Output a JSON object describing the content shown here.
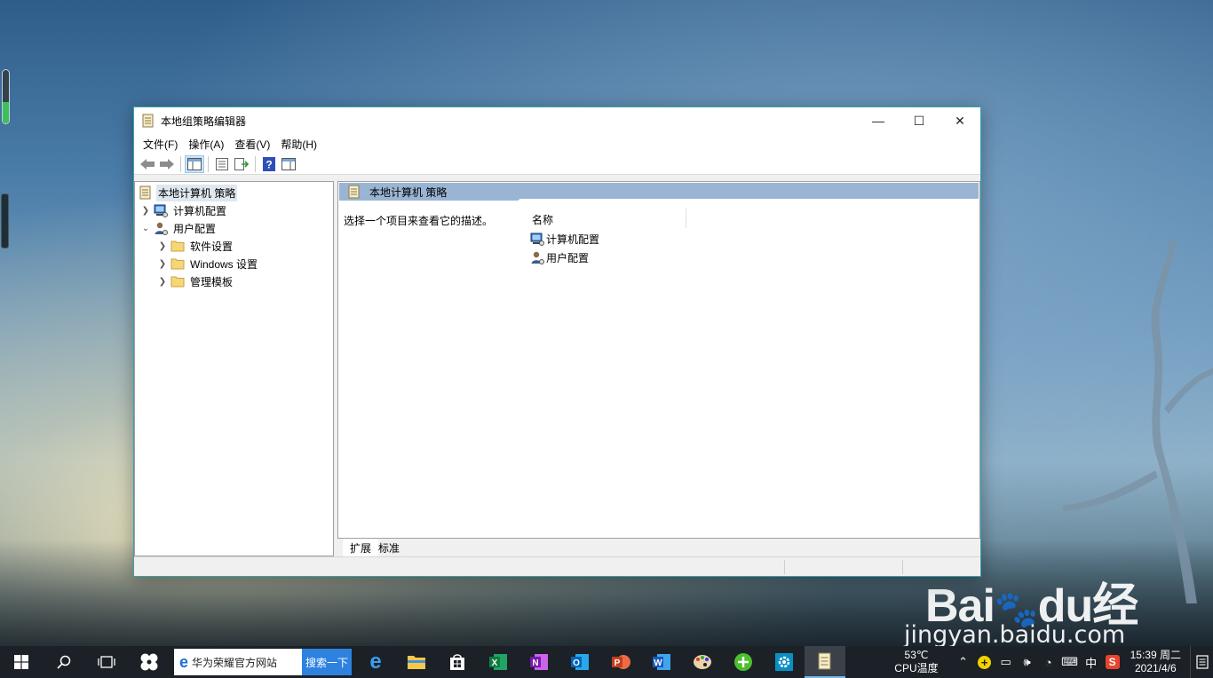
{
  "desktop": {
    "watermark_brand": "Bai",
    "watermark_brand_tail": "du",
    "watermark_cn": "经验",
    "watermark_url": "jingyan.baidu.com",
    "gadget_level": 0.4
  },
  "window": {
    "title": "本地组策略编辑器",
    "controls": {
      "minimize": "—",
      "maximize": "☐",
      "close": "✕"
    },
    "menu": [
      "文件(F)",
      "操作(A)",
      "查看(V)",
      "帮助(H)"
    ],
    "toolbar": [
      {
        "icon": "back-arrow-icon"
      },
      {
        "icon": "forward-arrow-icon"
      },
      {
        "icon": "show-hide-console-tree-icon",
        "active": true
      },
      {
        "icon": "properties-icon"
      },
      {
        "icon": "export-list-icon"
      },
      {
        "icon": "help-icon"
      },
      {
        "icon": "show-hide-action-pane-icon"
      }
    ],
    "tree": {
      "root": "本地计算机 策略",
      "computer_config": "计算机配置",
      "user_config": "用户配置",
      "software_settings": "软件设置",
      "windows_settings": "Windows 设置",
      "admin_templates": "管理模板"
    },
    "details": {
      "header": "本地计算机 策略",
      "description": "选择一个项目来查看它的描述。",
      "column_name": "名称",
      "items": [
        "计算机配置",
        "用户配置"
      ]
    },
    "tabs": [
      "扩展",
      "标准"
    ]
  },
  "taskbar": {
    "search_text": "华为荣耀官方网站",
    "search_button": "搜索一下",
    "cpu_temp": "53℃",
    "cpu_label": "CPU温度",
    "ime": "中",
    "time": "15:39 周二",
    "date": "2021/4/6",
    "colors": {
      "search_button": "#2d82e0",
      "running_indicator": "#76b9ed"
    }
  }
}
